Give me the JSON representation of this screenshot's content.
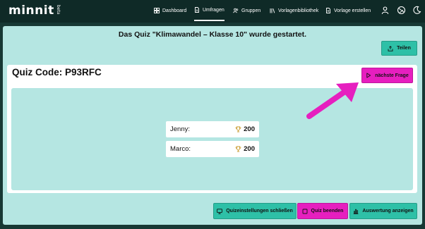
{
  "brand": {
    "name": "minnit",
    "badge": "beta"
  },
  "nav": {
    "items": [
      {
        "label": "Dashboard",
        "icon": "dashboard-icon"
      },
      {
        "label": "Umfragen",
        "icon": "document-icon",
        "active": true
      },
      {
        "label": "Gruppen",
        "icon": "group-icon"
      },
      {
        "label": "Vorlagenbibliothek",
        "icon": "library-icon"
      },
      {
        "label": "Vorlage erstellen",
        "icon": "document-plus-icon"
      }
    ],
    "right_icons": [
      "user-icon",
      "language-icon",
      "dark-mode-icon"
    ]
  },
  "main": {
    "headline": "Das Quiz \"Klimawandel – Klasse 10\" wurde gestartet.",
    "share_label": "Teilen",
    "quiz_code_label": "Quiz Code: P93RFC",
    "next_question_label": "nächste Frage",
    "leaderboard": [
      {
        "name": "Jenny:",
        "score": "200"
      },
      {
        "name": "Marco:",
        "score": "200"
      }
    ]
  },
  "footer": {
    "close_settings_label": "Quizeinstellungen schließen",
    "end_quiz_label": "Quiz beenden",
    "show_results_label": "Auswertung anzeigen"
  },
  "colors": {
    "nav_bg": "#0f2a27",
    "panel_bg": "#b5e6e2",
    "teal_button": "#2ec0a7",
    "pink_accent": "#e61fbf"
  }
}
